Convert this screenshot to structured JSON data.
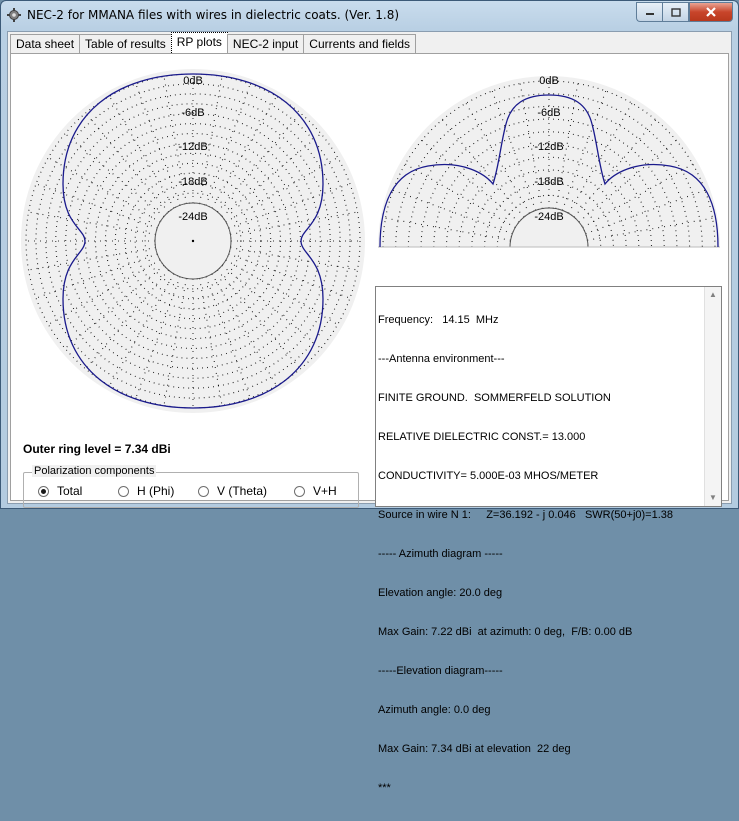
{
  "window": {
    "title": "NEC-2 for MMANA files with wires in dielectric coats. (Ver. 1.8)"
  },
  "tabs": [
    {
      "label": "Data sheet"
    },
    {
      "label": "Table of results"
    },
    {
      "label": "RP plots"
    },
    {
      "label": "NEC-2 input"
    },
    {
      "label": "Currents and fields"
    }
  ],
  "active_tab": "RP plots",
  "azimuth_plot": {
    "ring_labels": [
      "0dB",
      "-6dB",
      "-12dB",
      "-18dB",
      "-24dB"
    ]
  },
  "elevation_plot": {
    "ring_labels": [
      "0dB",
      "-6dB",
      "-12dB",
      "-18dB",
      "-24dB"
    ]
  },
  "outer_ring_level": "Outer ring level = 7.34 dBi",
  "polarization": {
    "legend": "Polarization components",
    "options": [
      "Total",
      "H (Phi)",
      "V (Theta)",
      "V+H"
    ],
    "selected": "Total"
  },
  "info_lines": [
    "Frequency:   14.15  MHz",
    "---Antenna environment---",
    "FINITE GROUND.  SOMMERFELD SOLUTION",
    "RELATIVE DIELECTRIC CONST.= 13.000",
    "CONDUCTIVITY= 5.000E-03 MHOS/METER",
    "Source in wire N 1:     Z=36.192 - j 0.046   SWR(50+j0)=1.38",
    "----- Azimuth diagram -----",
    "Elevation angle: 20.0 deg",
    "Max Gain: 7.22 dBi  at azimuth: 0 deg,  F/B: 0.00 dB",
    "-----Elevation diagram-----",
    "Azimuth angle: 0.0 deg",
    "Max Gain: 7.34 dBi at elevation  22 deg",
    "***"
  ],
  "colors": {
    "pattern": "#1a1a8c",
    "grid_dots": "#000000"
  },
  "icons": {
    "app": "gear-icon",
    "minimize": "minimize-icon",
    "maximize": "maximize-icon",
    "close": "close-icon"
  }
}
